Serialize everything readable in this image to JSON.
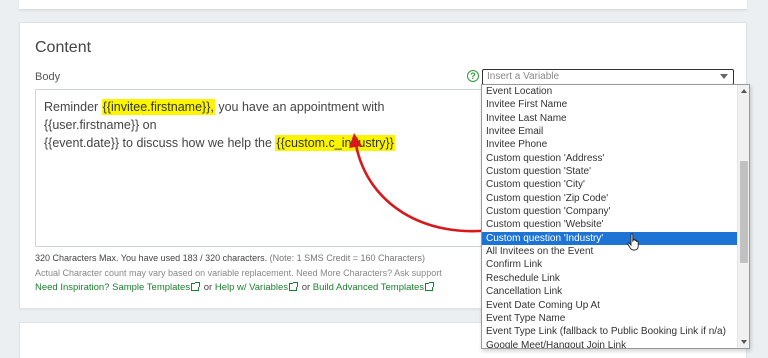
{
  "content": {
    "section_title": "Content",
    "body_label": "Body",
    "help_icon": "question-circle-icon",
    "variable_select": {
      "placeholder": "Insert a Variable"
    },
    "message": {
      "p1": "Reminder ",
      "v1": "{{invitee.firstname}},",
      "p2": " you have an appointment with {{user.firstname}} on",
      "p3": "{{event.date}} to discuss how we help the ",
      "v2": "{{custom.c_industry}}"
    },
    "counter": {
      "text": "320 Characters Max. You have used 183 / 320 characters.",
      "note": "(Note: 1 SMS Credit = 160 Characters)"
    },
    "variable_note": "Actual Character count may vary based on variable replacement. Need More Characters? Ask support",
    "links": {
      "inspiration_label": "Need Inspiration?",
      "sample_templates": "Sample Templates",
      "or1": "or",
      "help_variables": "Help w/ Variables",
      "or2": "or",
      "build_advanced": "Build Advanced Templates"
    }
  },
  "dropdown": {
    "items": [
      "Event Location",
      "Invitee First Name",
      "Invitee Last Name",
      "Invitee Email",
      "Invitee Phone",
      "Custom question 'Address'",
      "Custom question 'State'",
      "Custom question 'City'",
      "Custom question 'Zip Code'",
      "Custom question 'Company'",
      "Custom question 'Website'",
      "Custom question 'Industry'",
      "All Invitees on the Event",
      "Confirm Link",
      "Reschedule Link",
      "Cancellation Link",
      "Event Date Coming Up At",
      "Event Type Name",
      "Event Type Link (fallback to Public Booking Link if n/a)",
      "Google Meet/Hangout Join Link"
    ],
    "selected_index": 11
  },
  "colors": {
    "highlight": "#fbf500",
    "link_green": "#1a7f2e",
    "selected_blue": "#1e74d4",
    "annotation_arrow": "#d7191c"
  }
}
